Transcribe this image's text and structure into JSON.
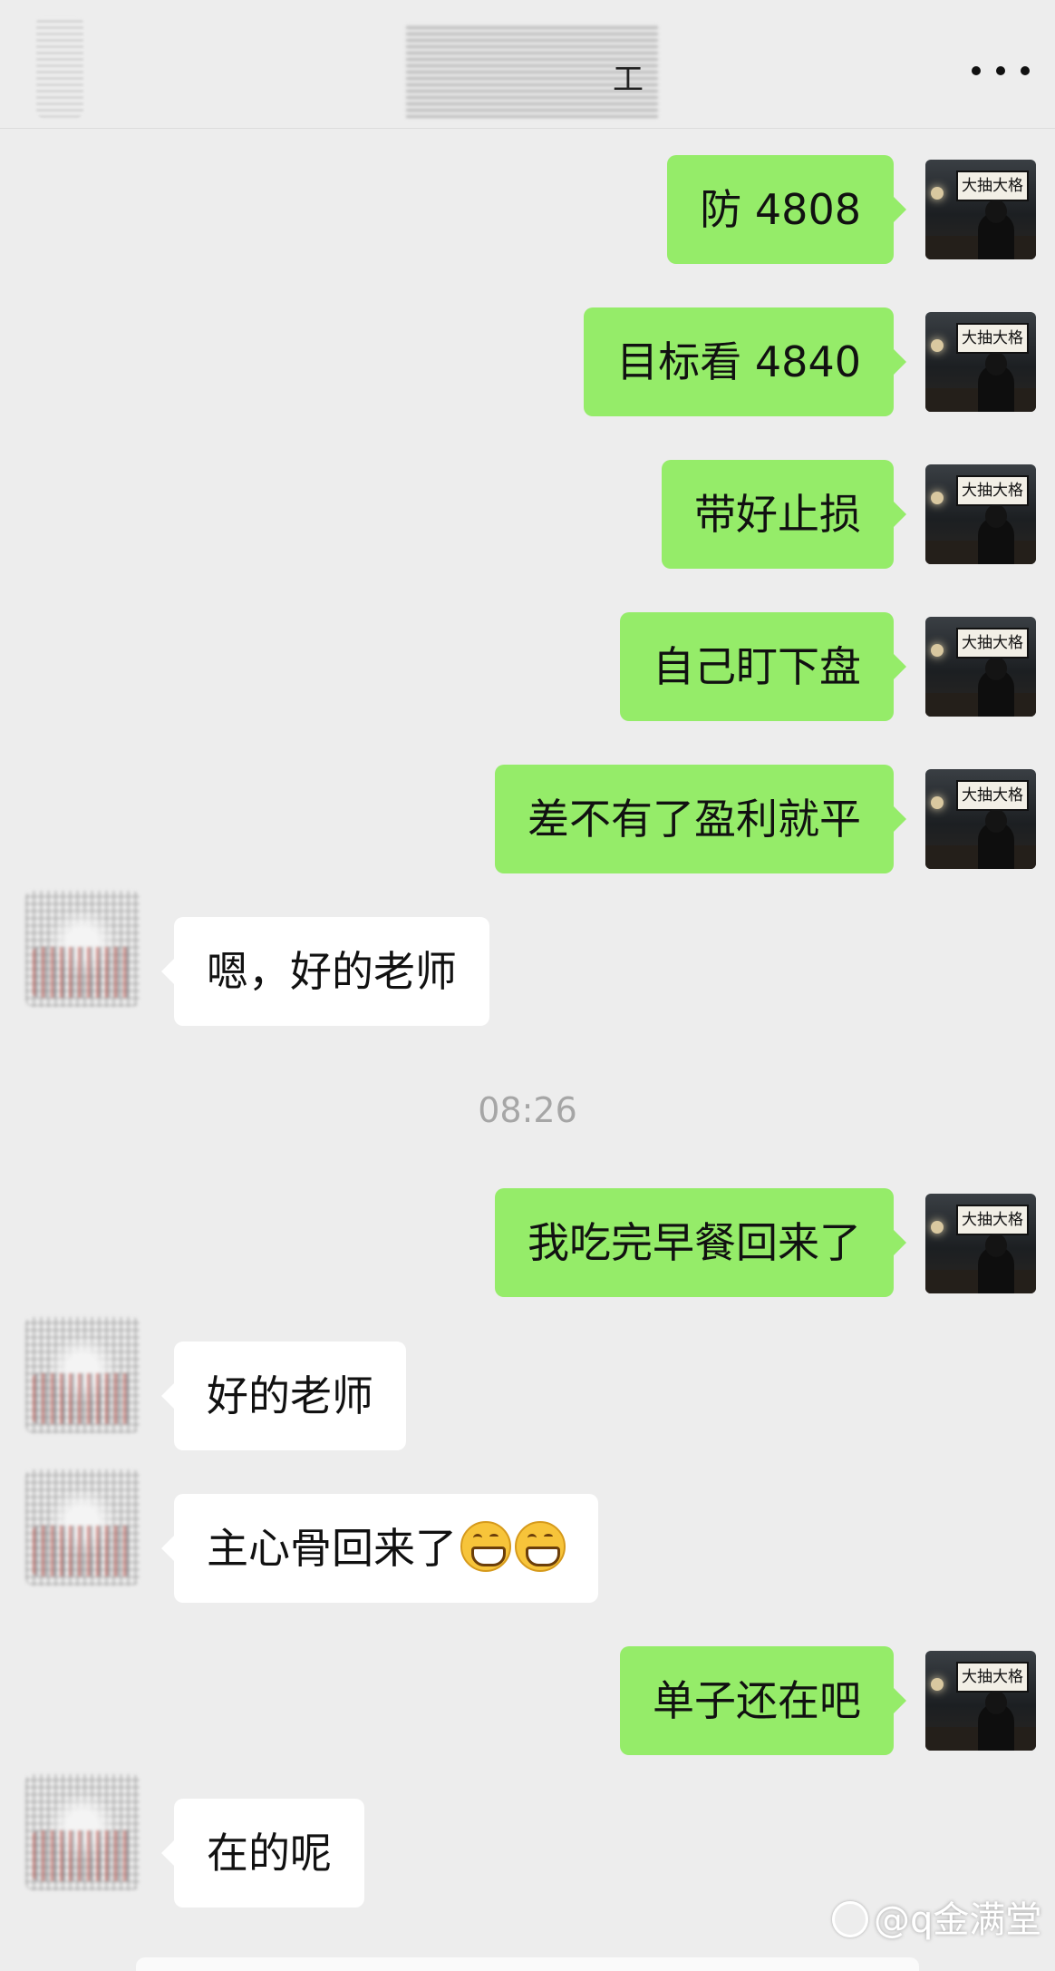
{
  "header": {
    "title_tail": "工",
    "more_icon": "more-horizontal-icon"
  },
  "self_avatar_sign": "大抽大格",
  "messages": [
    {
      "side": "out",
      "text": "防 4808"
    },
    {
      "side": "out",
      "text": "目标看 4840"
    },
    {
      "side": "out",
      "text": "带好止损"
    },
    {
      "side": "out",
      "text": "自己盯下盘"
    },
    {
      "side": "out",
      "text": "差不有了盈利就平"
    },
    {
      "side": "in",
      "text": "嗯，好的老师"
    },
    {
      "side": "out",
      "text": "我吃完早餐回来了"
    },
    {
      "side": "in",
      "text": "好的老师"
    },
    {
      "side": "in",
      "text": "主心骨回来了",
      "emoji": "grinning-face-icon x2"
    },
    {
      "side": "out",
      "text": "单子还在吧"
    },
    {
      "side": "in",
      "text": "在的呢"
    }
  ],
  "timestamp": "08:26",
  "watermark": "@q金满堂",
  "colors": {
    "background": "#ededed",
    "outgoing_bubble": "#95ec69",
    "incoming_bubble": "#ffffff",
    "timestamp": "#a6a6a6"
  }
}
